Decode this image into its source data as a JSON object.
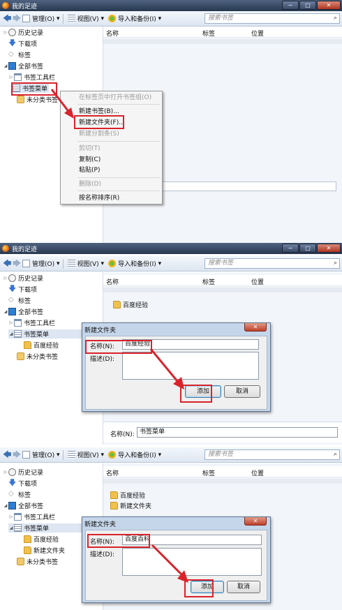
{
  "app": {
    "title": "我的足迹"
  },
  "toolbar": {
    "back_label": "🡄",
    "forward_label": "🡆",
    "manage_label": "管理(O)",
    "view_label": "视图(V)",
    "import_label": "导入和备份(I)",
    "search_placeholder": "搜索书签"
  },
  "window_buttons": {
    "minimize": "−",
    "maximize": "□",
    "close": "✕"
  },
  "columns": {
    "name": "名称",
    "tag": "标签",
    "location": "位置"
  },
  "tree": {
    "history": "历史记录",
    "downloads": "下载项",
    "tags": "标签",
    "all_bookmarks": "全部书签",
    "bookmarks_toolbar": "书签工具栏",
    "bookmarks_menu": "书签菜单",
    "folder_baidu_exp": "百度经验",
    "folder_new": "新建文件夹",
    "unsorted": "未分类书签"
  },
  "context_menu": {
    "items": [
      {
        "label": "在标签页中打开书签组(O)",
        "disabled": true
      },
      {
        "label": "新建书签(B)...",
        "disabled": false
      },
      {
        "label": "新建文件夹(F)...",
        "disabled": false
      },
      {
        "label": "新建分割条(S)",
        "disabled": true
      },
      {
        "label": "剪切(T)",
        "disabled": true
      },
      {
        "label": "复制(C)",
        "disabled": false
      },
      {
        "label": "粘贴(P)",
        "disabled": false
      },
      {
        "label": "删除(D)",
        "disabled": true
      },
      {
        "label": "按名称排序(R)",
        "disabled": false
      }
    ]
  },
  "dialog1": {
    "title": "新建文件夹",
    "name_label": "名称(N):",
    "name_value": "百度经验",
    "desc_label": "描述(D):",
    "add_button": "添加",
    "cancel_button": "取消"
  },
  "dialog2": {
    "title": "新建文件夹",
    "name_label": "名称(N):",
    "name_value": "百度百科",
    "desc_label": "描述(D):",
    "add_button": "添加",
    "cancel_button": "取消"
  },
  "details": {
    "name_label": "名称(N):",
    "name_value": "书签菜单"
  },
  "list_panel2": [
    "百度经验"
  ],
  "list_panel3": [
    "百度经验",
    "新建文件夹"
  ],
  "colors": {
    "highlight": "#d9232b",
    "titlebar": "#27384f",
    "selection": "#dde6f2"
  }
}
